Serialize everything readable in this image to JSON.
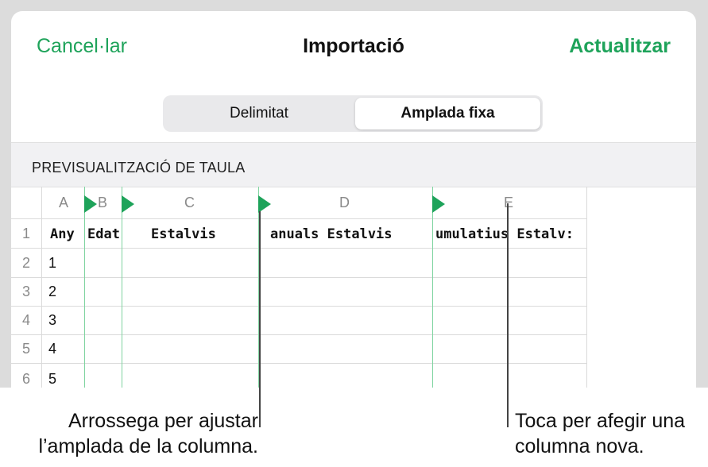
{
  "nav": {
    "cancel": "Cancel·lar",
    "title": "Importació",
    "update": "Actualitzar"
  },
  "segmented": {
    "option_1": "Delimitat",
    "option_2": "Amplada fixa",
    "selected": "Amplada fixa"
  },
  "preview": {
    "label": "PREVISUALITZACIÓ DE TAULA",
    "columns": [
      "A",
      "B",
      "C",
      "D",
      "E"
    ],
    "rows": [
      "1",
      "2",
      "3",
      "4",
      "5",
      "6"
    ],
    "header_cells": [
      "Any",
      "Edat",
      "Estalvis",
      "anuals Estalvis",
      "umulatius Estalv:"
    ],
    "first_column_values": [
      "1",
      "2",
      "3",
      "4",
      "5"
    ]
  },
  "captions": {
    "left_line_1": "Arrossega per ajustar",
    "left_line_2": "l’amplada de la columna.",
    "right_line_1": "Toca per afegir una",
    "right_line_2": "columna nova."
  },
  "colors": {
    "accent": "#1ea35a",
    "column_divider": "#7fd4a0"
  }
}
